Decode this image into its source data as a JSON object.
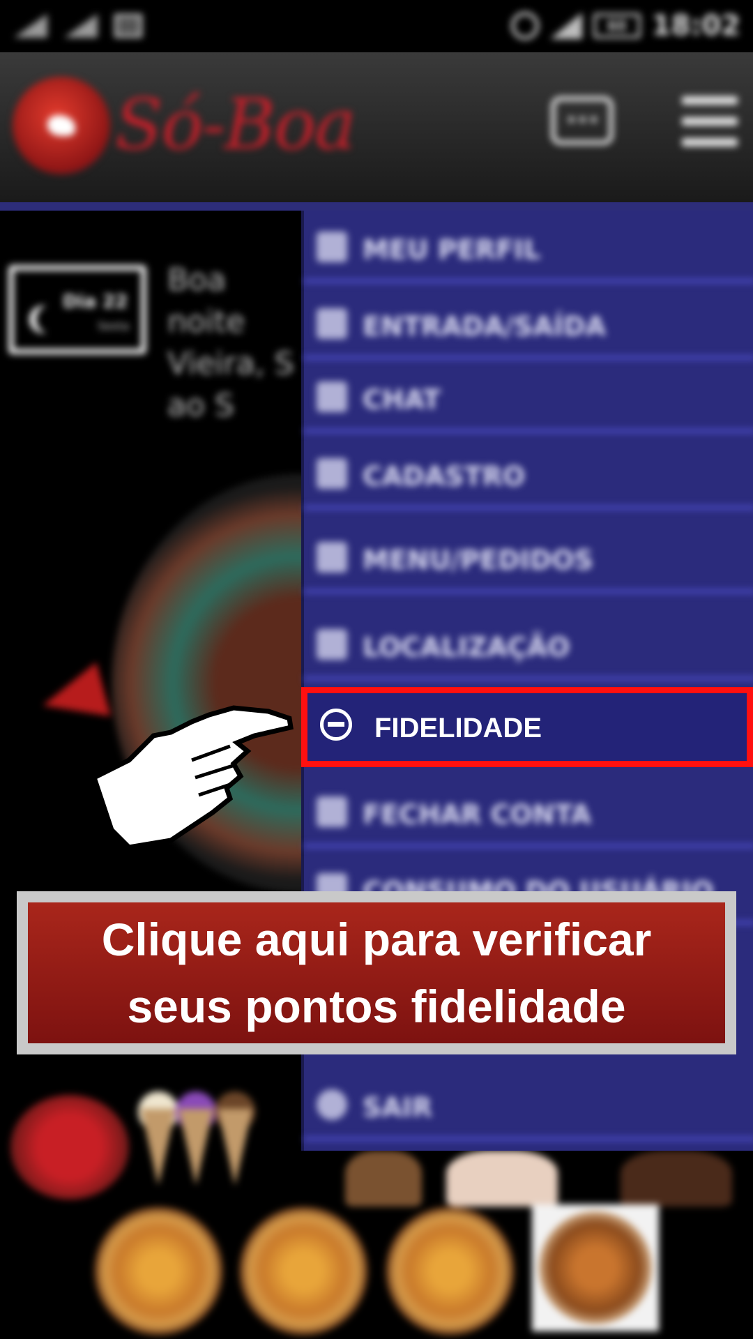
{
  "status_bar": {
    "time": "18:02",
    "battery": "60"
  },
  "header": {
    "logo_text": "Só-Boa",
    "chat_icon": "chat-bubble-icon",
    "menu_icon": "hamburger-icon"
  },
  "background": {
    "calendar_day": "Dia 22",
    "calendar_weekday": "Sexta",
    "greeting": "Boa noite Vieira, S ao S"
  },
  "drawer": {
    "items": [
      {
        "label": "MEU PERFIL",
        "icon": "user-icon"
      },
      {
        "label": "ENTRADA/SAÍDA",
        "icon": "door-icon"
      },
      {
        "label": "CHAT",
        "icon": "chat-icon"
      },
      {
        "label": "CADASTRO",
        "icon": "document-icon"
      },
      {
        "label": "MENU/PEDIDOS",
        "icon": "drinks-icon"
      },
      {
        "label": "LOCALIZAÇÃO",
        "icon": "location-pin-icon"
      },
      {
        "label": "FIDELIDADE",
        "icon": "badge-icon"
      },
      {
        "label": "FECHAR CONTA",
        "icon": "money-icon"
      },
      {
        "label": "CONSUMO DO USUÁRIO",
        "icon": "chart-icon"
      },
      {
        "label": "SAIR",
        "icon": "power-icon"
      }
    ]
  },
  "callout": {
    "line1": "Clique aqui para verificar",
    "line2": "seus pontos fidelidade"
  },
  "colors": {
    "drawer_bg": "#2b2b7c",
    "highlight_border": "#ff1010",
    "callout_bg": "#a9261b"
  }
}
